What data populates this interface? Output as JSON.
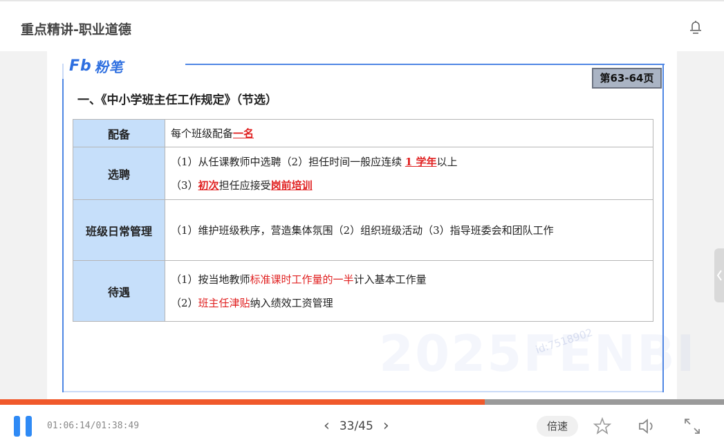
{
  "header": {
    "title": "重点精讲-职业道德",
    "icon": "bell-icon"
  },
  "slide": {
    "logo_text": "粉笔",
    "logo_mark": "Fb",
    "page_badge": "第63-64页",
    "heading": "一、《中小学班主任工作规定》（节选）",
    "rows": [
      {
        "label": "配备",
        "lines": [
          [
            {
              "t": "每个班级配备"
            },
            {
              "t": "一名",
              "style": "redu"
            }
          ]
        ]
      },
      {
        "label": "选聘",
        "lines": [
          [
            {
              "t": "（1）从任课教师中选聘（2）担任时间一般应连续 "
            },
            {
              "t": "1 学年",
              "style": "redu"
            },
            {
              "t": "以上"
            }
          ],
          [
            {
              "t": "（3）"
            },
            {
              "t": "初次",
              "style": "redu"
            },
            {
              "t": "担任应接受"
            },
            {
              "t": "岗前培训",
              "style": "redu"
            }
          ]
        ]
      },
      {
        "label": "班级日常管理",
        "lines": [
          [
            {
              "t": "（1）维护班级秩序，营造集体氛围（2）组织班级活动（3）指导班委会和团队工作"
            }
          ]
        ]
      },
      {
        "label": "待遇",
        "lines": [
          [
            {
              "t": "（1）按当地教师"
            },
            {
              "t": "标准课时工作量的一半",
              "style": "red"
            },
            {
              "t": "计入基本工作量"
            }
          ],
          [
            {
              "t": "（2）"
            },
            {
              "t": "班主任津贴",
              "style": "red"
            },
            {
              "t": "纳入绩效工资管理"
            }
          ]
        ]
      }
    ],
    "watermark": "2025FENBI",
    "watermark_id": "id:7518902"
  },
  "player": {
    "progress": 0.67,
    "time": "01:06:14/01:38:49",
    "page": "33/45",
    "speed_label": "倍速"
  },
  "colors": {
    "accent": "#2f8af5",
    "progress": "#f0592b",
    "highlight": "#e02020",
    "label_bg": "#c6dffa"
  }
}
